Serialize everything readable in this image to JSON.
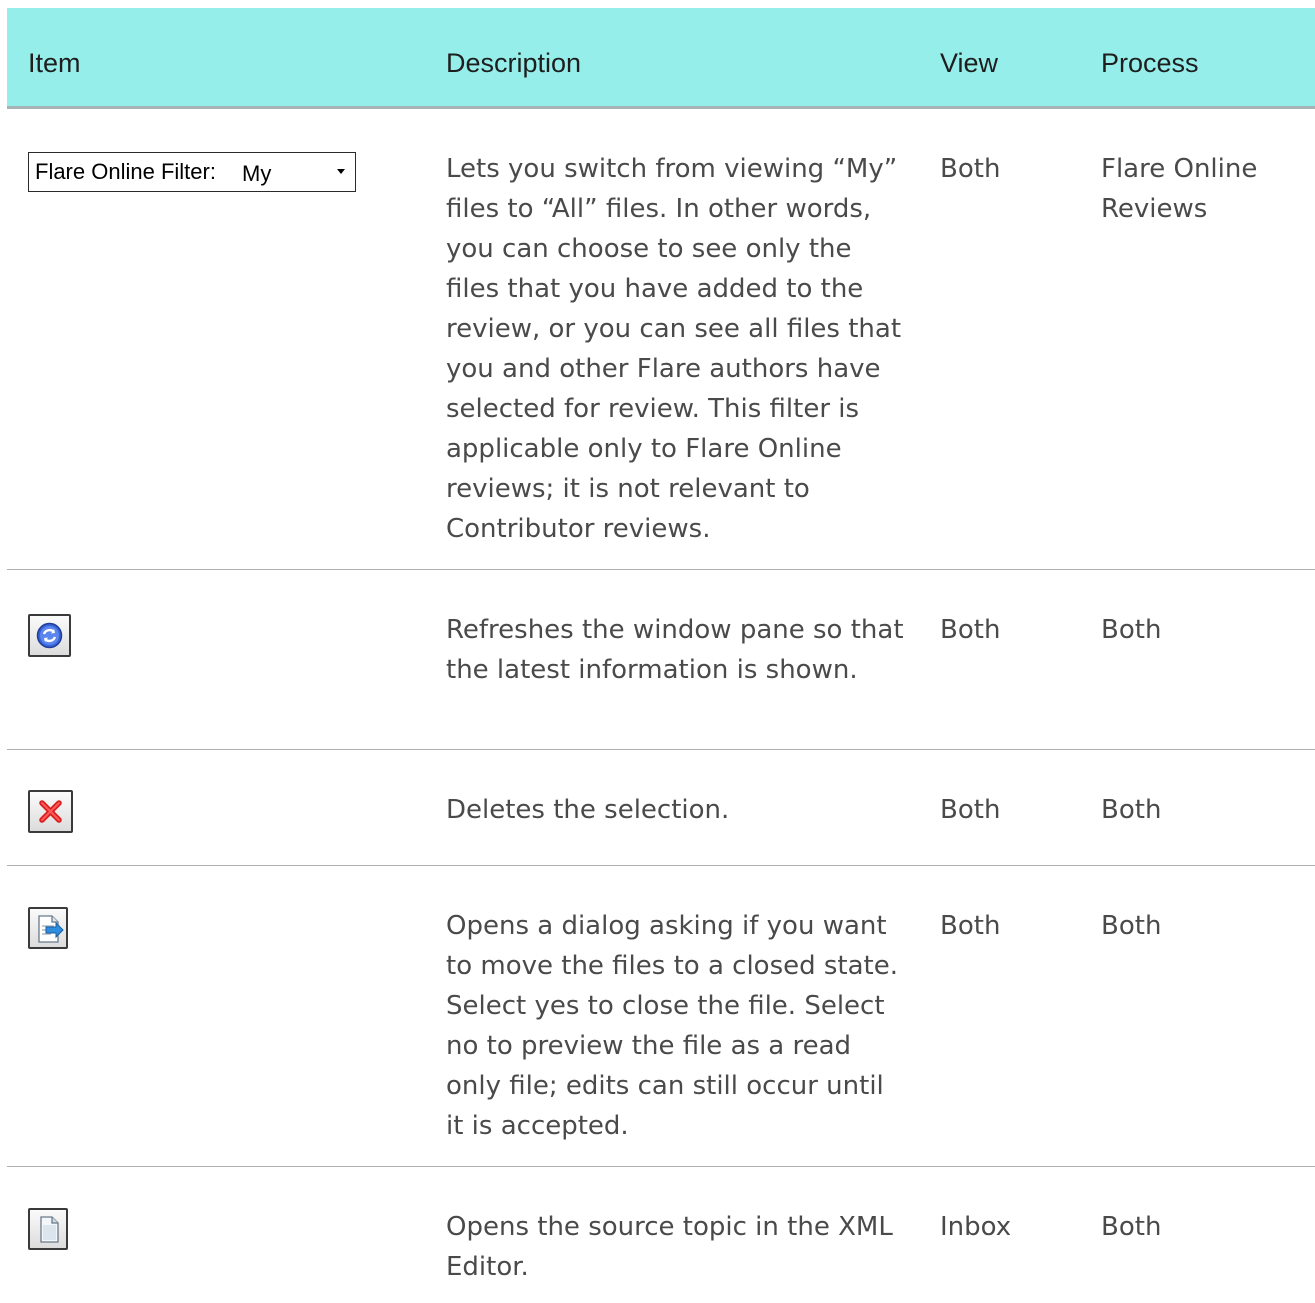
{
  "header": {
    "item": "Item",
    "description": "Description",
    "view": "View",
    "process": "Process"
  },
  "rows": [
    {
      "item_icon": "flare-online-filter-dropdown",
      "filter_label": "Flare Online Filter:",
      "filter_value": "My",
      "description": "Lets you switch from viewing “My” files to “All” files. In other words, you can choose to see only the files that you have added to the review, or you can see all files that you and other Flare authors have selected for review. This filter is applicable only to Flare Online reviews; it is not relevant to Contributor reviews.",
      "view": "Both",
      "process": "Flare Online Reviews"
    },
    {
      "item_icon": "refresh-icon",
      "description": "Refreshes the window pane so that the latest information is shown.",
      "view": "Both",
      "process": "Both"
    },
    {
      "item_icon": "delete-icon",
      "description": "Deletes the selection.",
      "view": "Both",
      "process": "Both"
    },
    {
      "item_icon": "open-review-file-icon",
      "description": "Opens a dialog asking if you want to move the files to a closed state. Select yes to close the file. Select no to preview the file as a read only file; edits can still occur until it is accepted.",
      "view": "Both",
      "process": "Both"
    },
    {
      "item_icon": "open-source-topic-icon",
      "description": "Opens the source topic in the XML Editor.",
      "view": "Inbox",
      "process": "Both"
    }
  ],
  "colors": {
    "header_bg": "#96eeea",
    "header_border": "#a7b2b4",
    "row_divider": "#b0b0b0",
    "text": "#4a4a4a"
  }
}
